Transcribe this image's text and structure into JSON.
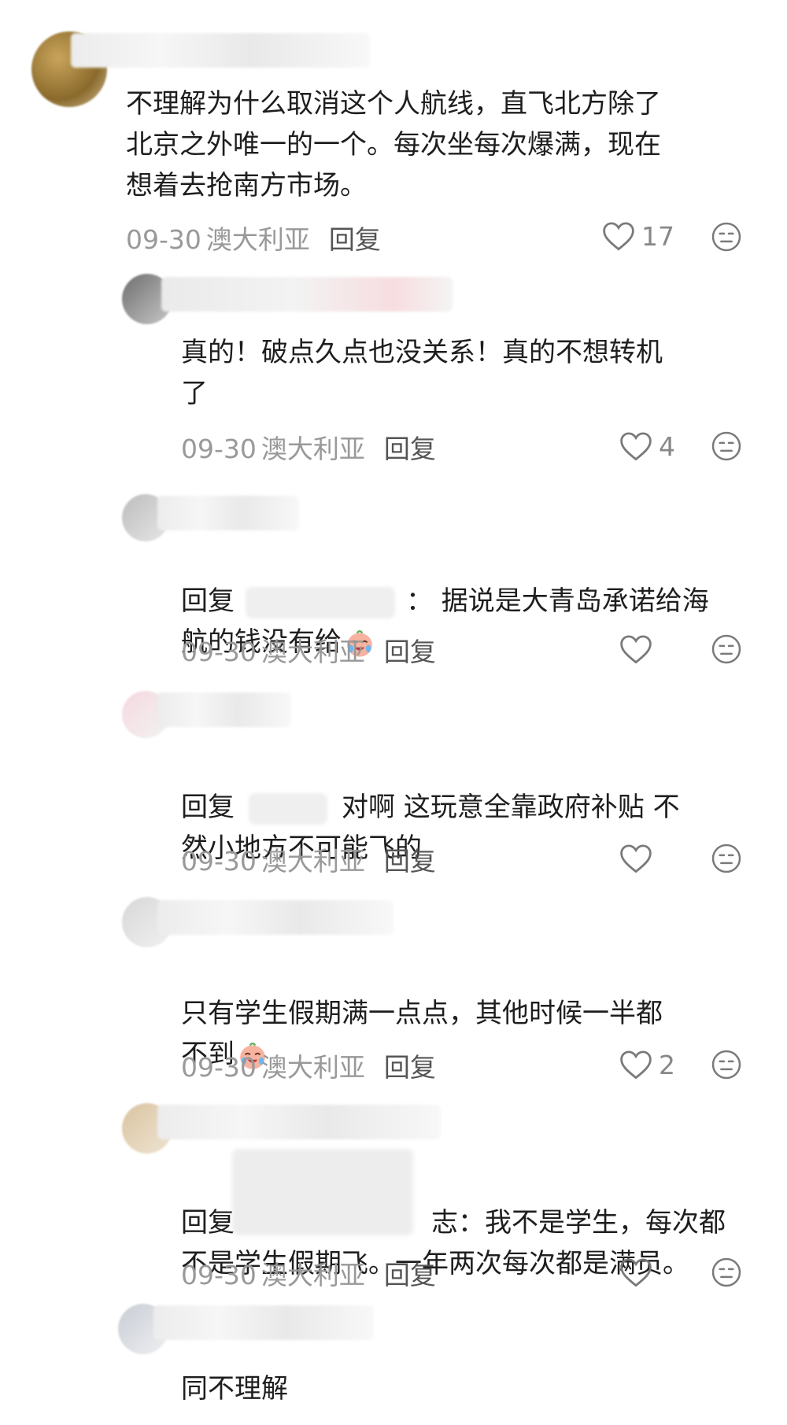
{
  "comments": [
    {
      "text": "不理解为什么取消这个人航线，直飞北方除了\n北京之外唯一的一个。每次坐每次爆满，现在\n想着去抢南方市场。",
      "date": "09-30",
      "location": "澳大利亚",
      "reply_label": "回复",
      "likes": "17"
    },
    {
      "text": "真的！破点久点也没关系！真的不想转机\n了",
      "date": "09-30",
      "location": "澳大利亚",
      "reply_label": "回复",
      "likes": "4"
    },
    {
      "prefix": "回复",
      "text": "：  据说是大青岛承诺给海\n航的钱没有给",
      "date": "09-30",
      "location": "澳大利亚",
      "reply_label": "回复",
      "likes": ""
    },
    {
      "prefix": "回复",
      "text": "对啊 这玩意全靠政府补贴 不\n然小地方不可能飞的",
      "date": "09-30",
      "location": "澳大利亚",
      "reply_label": "回复",
      "likes": ""
    },
    {
      "text": "只有学生假期满一点点，其他时候一半都\n不到",
      "date": "09-30",
      "location": "澳大利亚",
      "reply_label": "回复",
      "likes": "2"
    },
    {
      "prefix": "回复",
      "text": "志：我不是学生，每次都\n不是学生假期飞。一年两次每次都是满员。",
      "date": "09-30",
      "location": "澳大利亚",
      "reply_label": "回复",
      "likes": ""
    },
    {
      "text": "同不理解"
    }
  ],
  "colors": {
    "meta": "#999999",
    "text": "#1e1e1e",
    "icon": "#7a7a7a"
  },
  "icons": {
    "like": "heart-outline-icon",
    "dislike": "neutral-face-icon",
    "emoji": "crying-laugh-emoji-icon"
  }
}
